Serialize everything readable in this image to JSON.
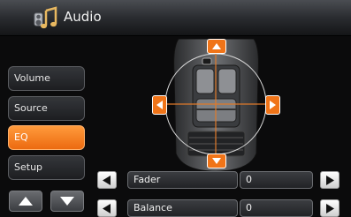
{
  "header": {
    "title": "Audio",
    "icon": "speaker-music-icon"
  },
  "sidebar": {
    "items": [
      {
        "label": "Volume",
        "active": false
      },
      {
        "label": "Source",
        "active": false
      },
      {
        "label": "EQ",
        "active": true
      },
      {
        "label": "Setup",
        "active": false
      }
    ],
    "page_up_icon": "triangle-up-icon",
    "page_down_icon": "triangle-down-icon"
  },
  "balance_fader": {
    "fader": {
      "label": "Fader",
      "value": "0"
    },
    "balance": {
      "label": "Balance",
      "value": "0"
    }
  },
  "colors": {
    "accent": "#f07418",
    "background": "#0b0b0c"
  }
}
